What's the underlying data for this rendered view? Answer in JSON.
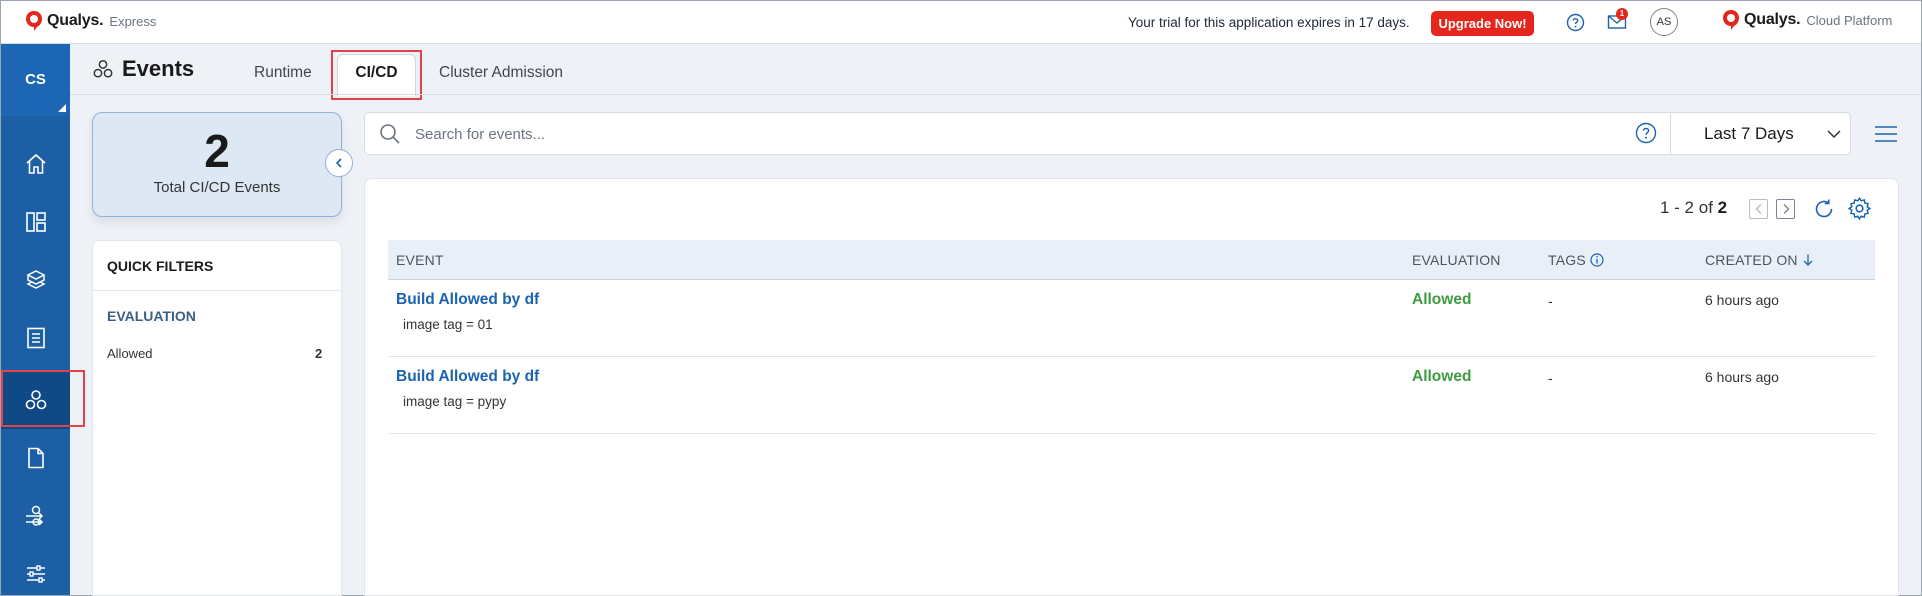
{
  "topbar": {
    "brand": "Qualys.",
    "brand_sub": "Express",
    "trial_text": "Your trial for this application expires in 17 days.",
    "upgrade_label": "Upgrade Now!",
    "mail_badge": "1",
    "avatar_initials": "AS",
    "cloud_brand": "Qualys.",
    "cloud_sub": "Cloud Platform",
    "accent": "#e4261c"
  },
  "sidebar": {
    "header": "CS",
    "items": [
      {
        "icon": "home-icon",
        "active": false
      },
      {
        "icon": "dashboard-icon",
        "active": false
      },
      {
        "icon": "inventory-icon",
        "active": false
      },
      {
        "icon": "report-icon",
        "active": false
      },
      {
        "icon": "events-icon",
        "active": true
      },
      {
        "icon": "document-icon",
        "active": false
      },
      {
        "icon": "policy-icon",
        "active": false
      },
      {
        "icon": "settings-sliders-icon",
        "active": false
      }
    ]
  },
  "page": {
    "title": "Events",
    "tabs": [
      {
        "label": "Runtime",
        "active": false
      },
      {
        "label": "CI/CD",
        "active": true
      },
      {
        "label": "Cluster Admission",
        "active": false
      }
    ]
  },
  "summary": {
    "count": "2",
    "label": "Total CI/CD Events"
  },
  "filters": {
    "title": "QUICK FILTERS",
    "section": "EVALUATION",
    "options": [
      {
        "label": "Allowed",
        "count": "2"
      }
    ]
  },
  "search": {
    "placeholder": "Search for events...",
    "date_range": "Last 7 Days"
  },
  "table": {
    "pager_range": "1 - 2 of",
    "pager_total": "2",
    "columns": [
      "EVENT",
      "EVALUATION",
      "TAGS",
      "CREATED ON"
    ],
    "rows": [
      {
        "event": "Build Allowed by df",
        "detail": "image tag = 01",
        "evaluation": "Allowed",
        "tags": "-",
        "created": "6 hours ago"
      },
      {
        "event": "Build Allowed by df",
        "detail": "image tag = pypy",
        "evaluation": "Allowed",
        "tags": "-",
        "created": "6 hours ago"
      }
    ]
  }
}
